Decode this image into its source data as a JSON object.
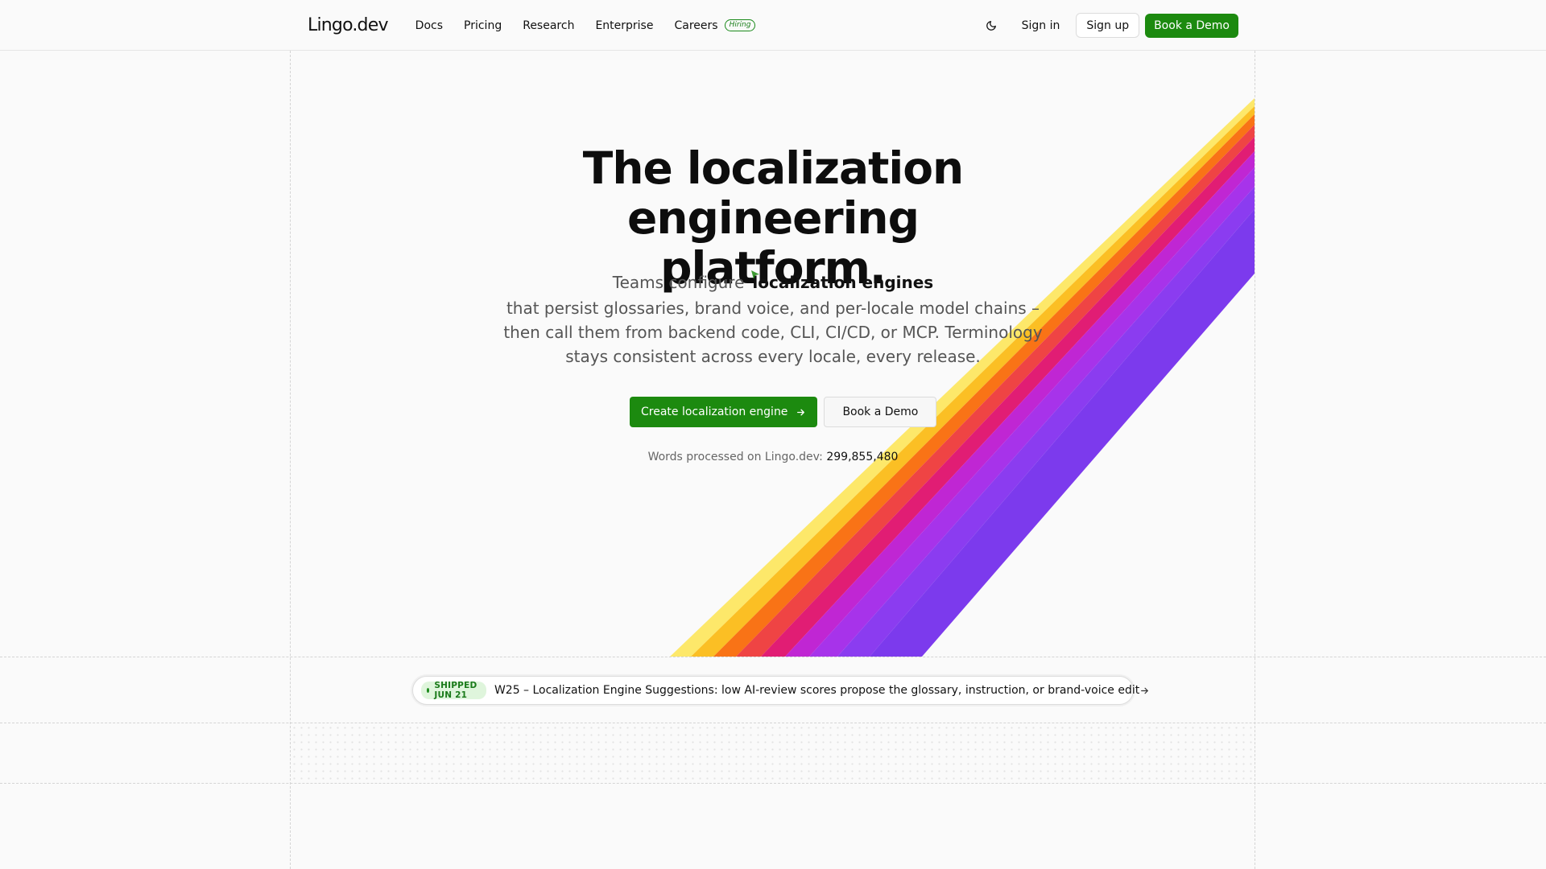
{
  "header": {
    "logo": "Lingo.dev",
    "nav": [
      {
        "label": "Docs"
      },
      {
        "label": "Pricing"
      },
      {
        "label": "Research"
      },
      {
        "label": "Enterprise"
      },
      {
        "label": "Careers",
        "badge": "Hiring"
      }
    ],
    "theme_icon": "moon-icon",
    "sign_in": "Sign in",
    "sign_up": "Sign up",
    "book_demo": "Book a Demo"
  },
  "hero": {
    "title_line1": "The localization engineering",
    "title_line2": "platform.",
    "subtitle_prefix": "Teams configure",
    "subtitle_highlight": "localization engines",
    "subtitle_line2": "that persist glossaries, brand voice, and per-locale model chains –",
    "subtitle_line3": "then call them from backend code, CLI, CI/CD, or MCP. Terminology",
    "subtitle_line4": "stays consistent across every locale, every release.",
    "cta_primary": "Create localization engine",
    "cta_secondary": "Book a Demo",
    "words_label": "Words processed on Lingo.dev:",
    "words_count": "299,855,480"
  },
  "announcement": {
    "badge": "SHIPPED JUN 21",
    "text": "W25 – Localization Engine Suggestions: low AI-review scores propose the glossary, instruction, or brand-voice edit",
    "arrow_icon": "arrow-right-icon"
  },
  "colors": {
    "brand_green": "#1c8a0f",
    "rainbow": [
      "#fde86a",
      "#fbbf24",
      "#f97316",
      "#ef4444",
      "#e11d74",
      "#c026d3",
      "#a733ea",
      "#8b3cf0",
      "#7c3aed"
    ]
  }
}
